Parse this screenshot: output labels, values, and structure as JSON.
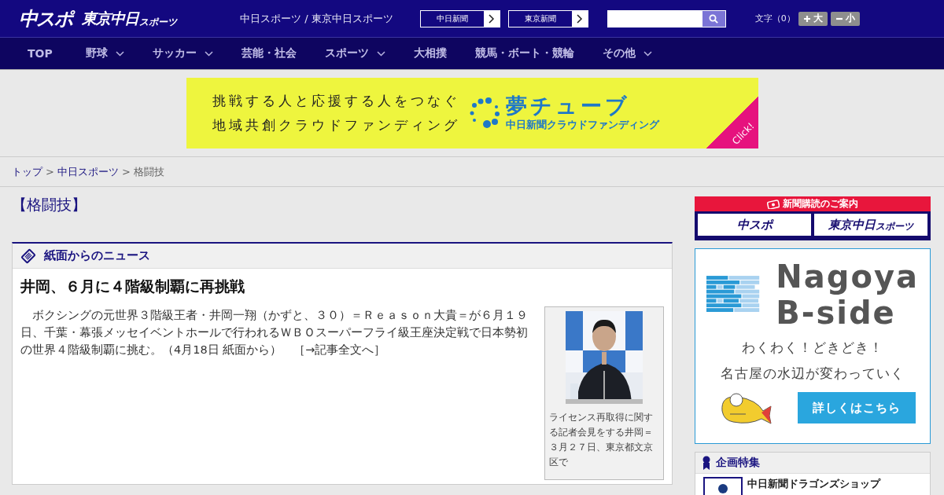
{
  "header": {
    "logo_main": "中スポ",
    "logo_tokyo": "東京中日",
    "logo_tokyo_small": "スポーツ",
    "site_title": "中日スポーツ / 東京中日スポーツ",
    "paper_links": [
      "中日新聞",
      "東京新聞"
    ],
    "font_size": {
      "label": "文字（0）",
      "buttons": [
        {
          "kind": "plus",
          "label": "大"
        },
        {
          "kind": "minus",
          "label": "小"
        }
      ]
    }
  },
  "nav": [
    {
      "label": "TOP",
      "dropdown": false
    },
    {
      "label": "野球",
      "dropdown": true
    },
    {
      "label": "サッカー",
      "dropdown": true
    },
    {
      "label": "芸能・社会",
      "dropdown": false
    },
    {
      "label": "スポーツ",
      "dropdown": true
    },
    {
      "label": "大相撲",
      "dropdown": false
    },
    {
      "label": "競馬・ボート・競輪",
      "dropdown": false
    },
    {
      "label": "その他",
      "dropdown": true
    }
  ],
  "banner": {
    "lines": [
      "挑戦する人と応援する人をつなぐ",
      "地域共創クラウドファンディング"
    ],
    "brand": "夢チューブ",
    "brand_sub": "中日新聞クラウドファンディング",
    "corner": "Click!"
  },
  "breadcrumb": [
    {
      "label": "トップ",
      "link": true
    },
    {
      "separator": ">",
      "label": "中日スポーツ",
      "link": true
    },
    {
      "separator": ">",
      "label": "格闘技",
      "link": false
    }
  ],
  "category_title": "【格闘技】",
  "news_box": {
    "heading": "紙面からのニュース",
    "article": {
      "title": "井岡、６月に４階級制覇に再挑戦",
      "body": "　ボクシングの元世界３階級王者・井岡一翔（かずと、３０）＝Ｒｅａｓｏｎ大貴＝が６月１９日、千葉・幕張メッセイベントホールで行われるＷＢＯスーパーフライ級王座決定戦で日本勢初の世界４階級制覇に挑む。（4月18日 紙面から）",
      "more_link": "［→記事全文へ］",
      "photo": {
        "kind": "picture",
        "caption": "ライセンス再取得に関する記者会見をする井岡＝３月２７日、東京都文京区で"
      }
    }
  },
  "sidebar": {
    "subscribe": {
      "heading": "新聞購読のご案内",
      "logos": [
        "中スポ",
        "東京中日"
      ],
      "logo_small": "スポーツ"
    },
    "ad": {
      "title_lines": [
        "Nagoya",
        "B-side"
      ],
      "copy": [
        "わくわく！どきどき！",
        "名古屋の水辺が変わっていく"
      ],
      "button": "詳しくはこちら"
    },
    "features": {
      "heading": "企画特集",
      "items": [
        "中日新聞ドラゴンズショップ"
      ]
    }
  }
}
